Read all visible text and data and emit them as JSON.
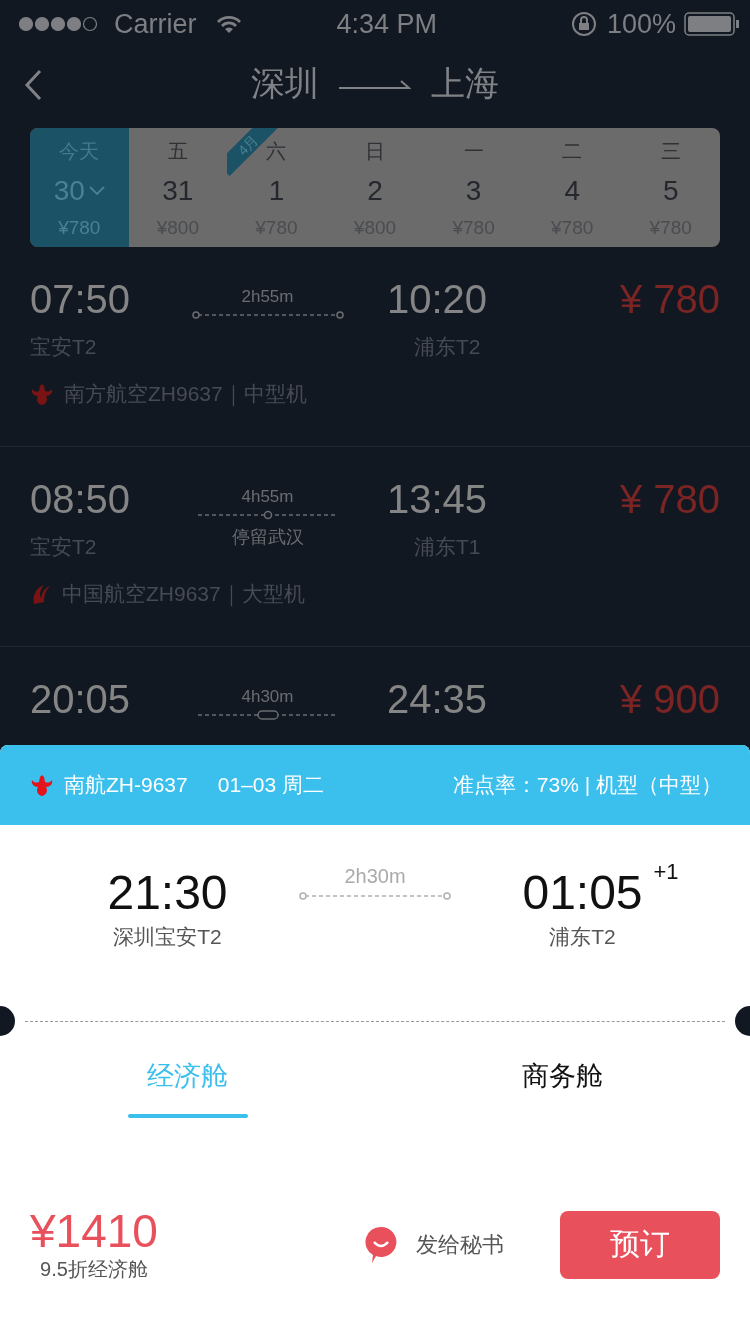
{
  "status_bar": {
    "carrier": "Carrier",
    "time": "4:34 PM",
    "battery": "100%"
  },
  "nav": {
    "from": "深圳",
    "to": "上海"
  },
  "dates": [
    {
      "weekday": "今天",
      "day": "30",
      "price": "¥780",
      "selected": true
    },
    {
      "weekday": "五",
      "day": "31",
      "price": "¥800",
      "selected": false
    },
    {
      "weekday": "六",
      "day": "1",
      "price": "¥780",
      "selected": false,
      "month_badge": "4月"
    },
    {
      "weekday": "日",
      "day": "2",
      "price": "¥800",
      "selected": false
    },
    {
      "weekday": "一",
      "day": "3",
      "price": "¥780",
      "selected": false
    },
    {
      "weekday": "二",
      "day": "4",
      "price": "¥780",
      "selected": false
    },
    {
      "weekday": "三",
      "day": "5",
      "price": "¥780",
      "selected": false
    }
  ],
  "flights": [
    {
      "depart": "07:50",
      "route": {
        "kind": "direct",
        "duration": "2h55m"
      },
      "arrive": "10:20",
      "price": "¥ 780",
      "from_terminal": "宝安T2",
      "to_terminal": "浦东T2",
      "airline": {
        "kind": "southern",
        "text": "南方航空ZH9637｜中型机"
      }
    },
    {
      "depart": "08:50",
      "route": {
        "kind": "stop",
        "duration": "4h55m",
        "stop": "停留武汉"
      },
      "arrive": "13:45",
      "price": "¥ 780",
      "from_terminal": "宝安T2",
      "to_terminal": "浦东T1",
      "airline": {
        "kind": "china",
        "text": "中国航空ZH9637｜大型机"
      }
    },
    {
      "depart": "20:05",
      "route": {
        "kind": "transfer",
        "duration": "4h30m"
      },
      "arrive": "24:35",
      "price": "¥ 900"
    }
  ],
  "sheet": {
    "airline": "南航ZH-9637",
    "date": "01–03 周二",
    "info": "准点率：73% | 机型（中型）",
    "depart_time": "21:30",
    "depart_airport": "深圳宝安T2",
    "duration": "2h30m",
    "arrive_time": "01:05",
    "day_offset": "+1",
    "arrive_airport": "浦东T2",
    "tabs": [
      {
        "label": "经济舱",
        "selected": true
      },
      {
        "label": "商务舱",
        "selected": false
      }
    ],
    "price": "¥1410",
    "discount": "9.5折经济舱",
    "send": "发给秘书",
    "book": "预订"
  }
}
